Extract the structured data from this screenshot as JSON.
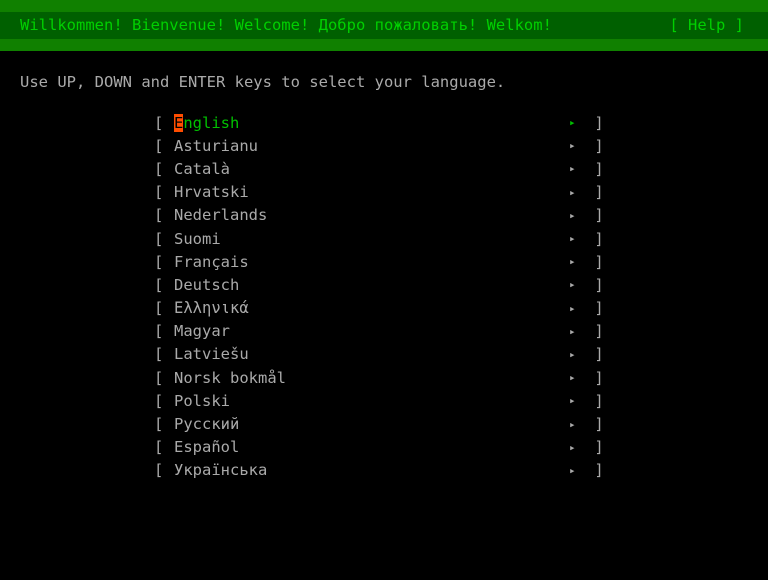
{
  "header": {
    "welcome": "Willkommen! Bienvenue! Welcome! Добро пожаловать! Welkom!",
    "help": "[ Help ]"
  },
  "instructions": "Use UP, DOWN and ENTER keys to select your language.",
  "brackets": {
    "left": "[ ",
    "right": " ]",
    "arrow": "▸"
  },
  "languages": [
    {
      "label": "English",
      "selected": true,
      "cursor_first": "E",
      "rest": "nglish"
    },
    {
      "label": "Asturianu",
      "selected": false
    },
    {
      "label": "Català",
      "selected": false
    },
    {
      "label": "Hrvatski",
      "selected": false
    },
    {
      "label": "Nederlands",
      "selected": false
    },
    {
      "label": "Suomi",
      "selected": false
    },
    {
      "label": "Français",
      "selected": false
    },
    {
      "label": "Deutsch",
      "selected": false
    },
    {
      "label": "Ελληνικά",
      "selected": false
    },
    {
      "label": "Magyar",
      "selected": false
    },
    {
      "label": "Latviešu",
      "selected": false
    },
    {
      "label": "Norsk bokmål",
      "selected": false
    },
    {
      "label": "Polski",
      "selected": false
    },
    {
      "label": "Русский",
      "selected": false
    },
    {
      "label": "Español",
      "selected": false
    },
    {
      "label": "Українська",
      "selected": false
    }
  ]
}
